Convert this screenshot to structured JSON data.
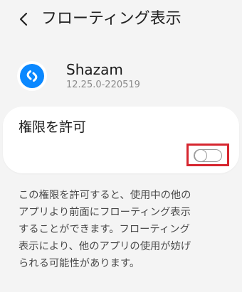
{
  "header": {
    "title": "フローティング表示",
    "back_icon": "chevron-left-icon"
  },
  "app": {
    "name": "Shazam",
    "version": "12.25.0-220519",
    "icon": "shazam-logo-icon",
    "icon_color": "#0b88ff"
  },
  "permission": {
    "label": "権限を許可",
    "toggle_state": "off",
    "highlight_color": "#d6262f"
  },
  "description": {
    "lines": [
      "この権限を許可すると、使用中の他の",
      "アプリより前面にフローティング表示",
      "することができます。フローティング",
      "表示により、他のアプリの使用が妨げ",
      "られる可能性があります。"
    ]
  }
}
